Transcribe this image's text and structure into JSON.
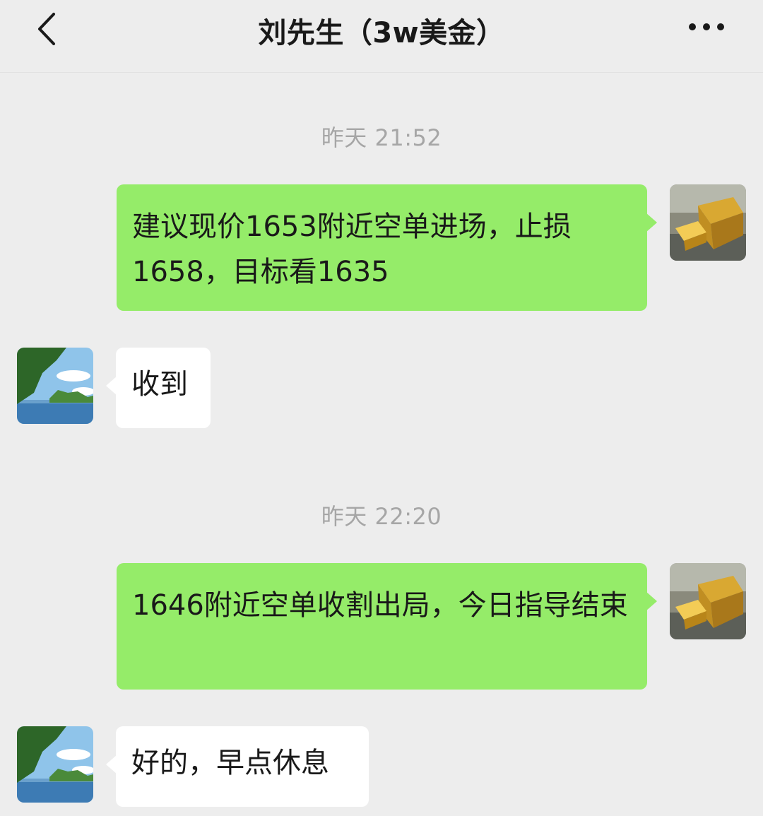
{
  "header": {
    "title": "刘先生（3w美金）",
    "back_icon": "chevron-left-icon",
    "more_icon": "more-horizontal-icon"
  },
  "messages": [
    {
      "timestamp": "昨天 21:52",
      "sender": "self",
      "text": "建议现价1653附近空单进场，止损1658，目标看1635"
    },
    {
      "sender": "other",
      "text": "收到"
    },
    {
      "timestamp": "昨天 22:20",
      "sender": "self",
      "text": "1646附近空单收割出局，今日指导结束"
    },
    {
      "sender": "other",
      "text": "好的，早点休息"
    }
  ],
  "colors": {
    "background": "#ededed",
    "sent_bubble": "#95ec69",
    "received_bubble": "#ffffff",
    "timestamp_text": "#a6a6a6"
  }
}
